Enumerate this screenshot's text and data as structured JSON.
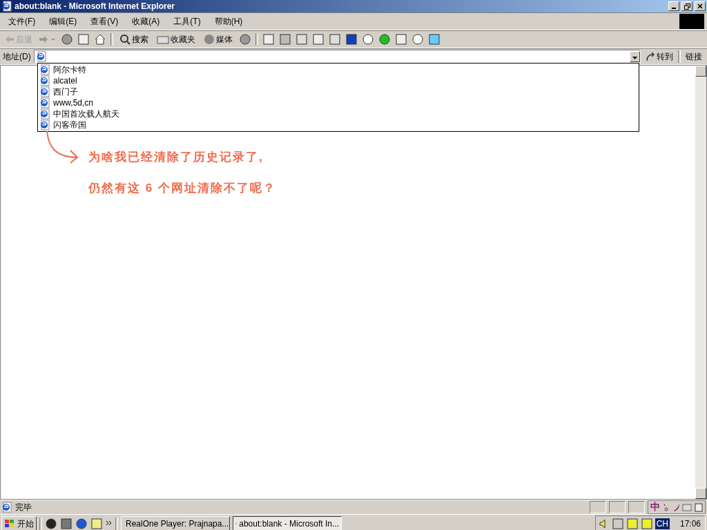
{
  "window": {
    "title": "about:blank - Microsoft Internet Explorer"
  },
  "menu": [
    "文件(F)",
    "编辑(E)",
    "查看(V)",
    "收藏(A)",
    "工具(T)",
    "帮助(H)"
  ],
  "toolbar": {
    "back": {
      "label": "后退",
      "disabled": true
    },
    "search": "搜索",
    "favorites": "收藏夹",
    "media": "媒体"
  },
  "address_bar": {
    "label": "地址(D)",
    "go": "转到",
    "links": "链接"
  },
  "autocomplete": [
    "阿尔卡特",
    "alcatel",
    "西门子",
    "www,5d,cn",
    "中国首次载人航天",
    "闪客帝国"
  ],
  "annotation": [
    "为啥我已经清除了历史记录了,",
    "仍然有这 6 个网址清除不了呢？"
  ],
  "status_bar": {
    "text": "完毕",
    "ime_mode": "中"
  },
  "taskbar": {
    "start": "开始",
    "tasks": [
      {
        "label": "RealOne Player: Prajnapa...",
        "selected": false
      },
      {
        "label": "about:blank - Microsoft In...",
        "selected": true
      }
    ],
    "language": "CH",
    "clock": "17:06"
  }
}
